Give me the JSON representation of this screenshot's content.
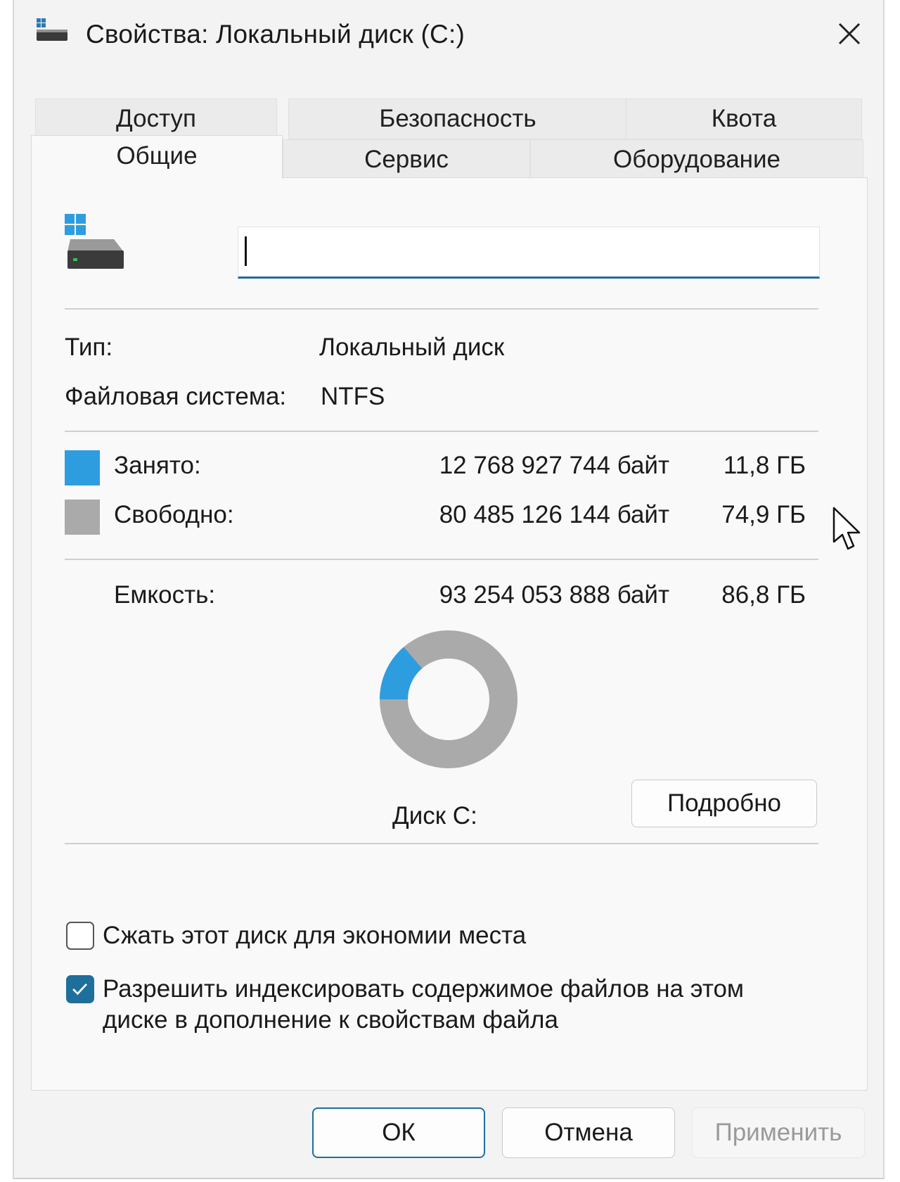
{
  "window": {
    "title": "Свойства: Локальный диск (C:)",
    "close_icon": "close-icon"
  },
  "tabs": {
    "back_row": [
      {
        "label": "Доступ"
      },
      {
        "label": "Безопасность"
      },
      {
        "label": "Квота"
      }
    ],
    "front_row": [
      {
        "label": "Общие",
        "active": true
      },
      {
        "label": "Сервис",
        "active": false
      },
      {
        "label": "Оборудование",
        "active": false
      }
    ]
  },
  "general": {
    "drive_icon": "drive-icon",
    "name_value": "",
    "type_label": "Тип:",
    "type_value": "Локальный диск",
    "fs_label": "Файловая система:",
    "fs_value": "NTFS",
    "used_label": "Занято:",
    "used_bytes": "12 768 927 744 байт",
    "used_size": "11,8 ГБ",
    "free_label": "Свободно:",
    "free_bytes": "80 485 126 144 байт",
    "free_size": "74,9 ГБ",
    "capacity_label": "Емкость:",
    "capacity_bytes": "93 254 053 888 байт",
    "capacity_size": "86,8 ГБ",
    "used_fraction": 0.137,
    "disk_label": "Диск C:",
    "details_button": "Подробно",
    "compress_label": "Сжать этот диск для экономии места",
    "compress_checked": false,
    "index_label_line1": "Разрешить индексировать содержимое файлов на этом",
    "index_label_line2": "диске в дополнение к свойствам файла",
    "index_checked": true
  },
  "colors": {
    "used": "#2d9de0",
    "free": "#aaaaaa",
    "accent": "#1e6f9c"
  },
  "footer": {
    "ok": "ОК",
    "cancel": "Отмена",
    "apply": "Применить"
  }
}
